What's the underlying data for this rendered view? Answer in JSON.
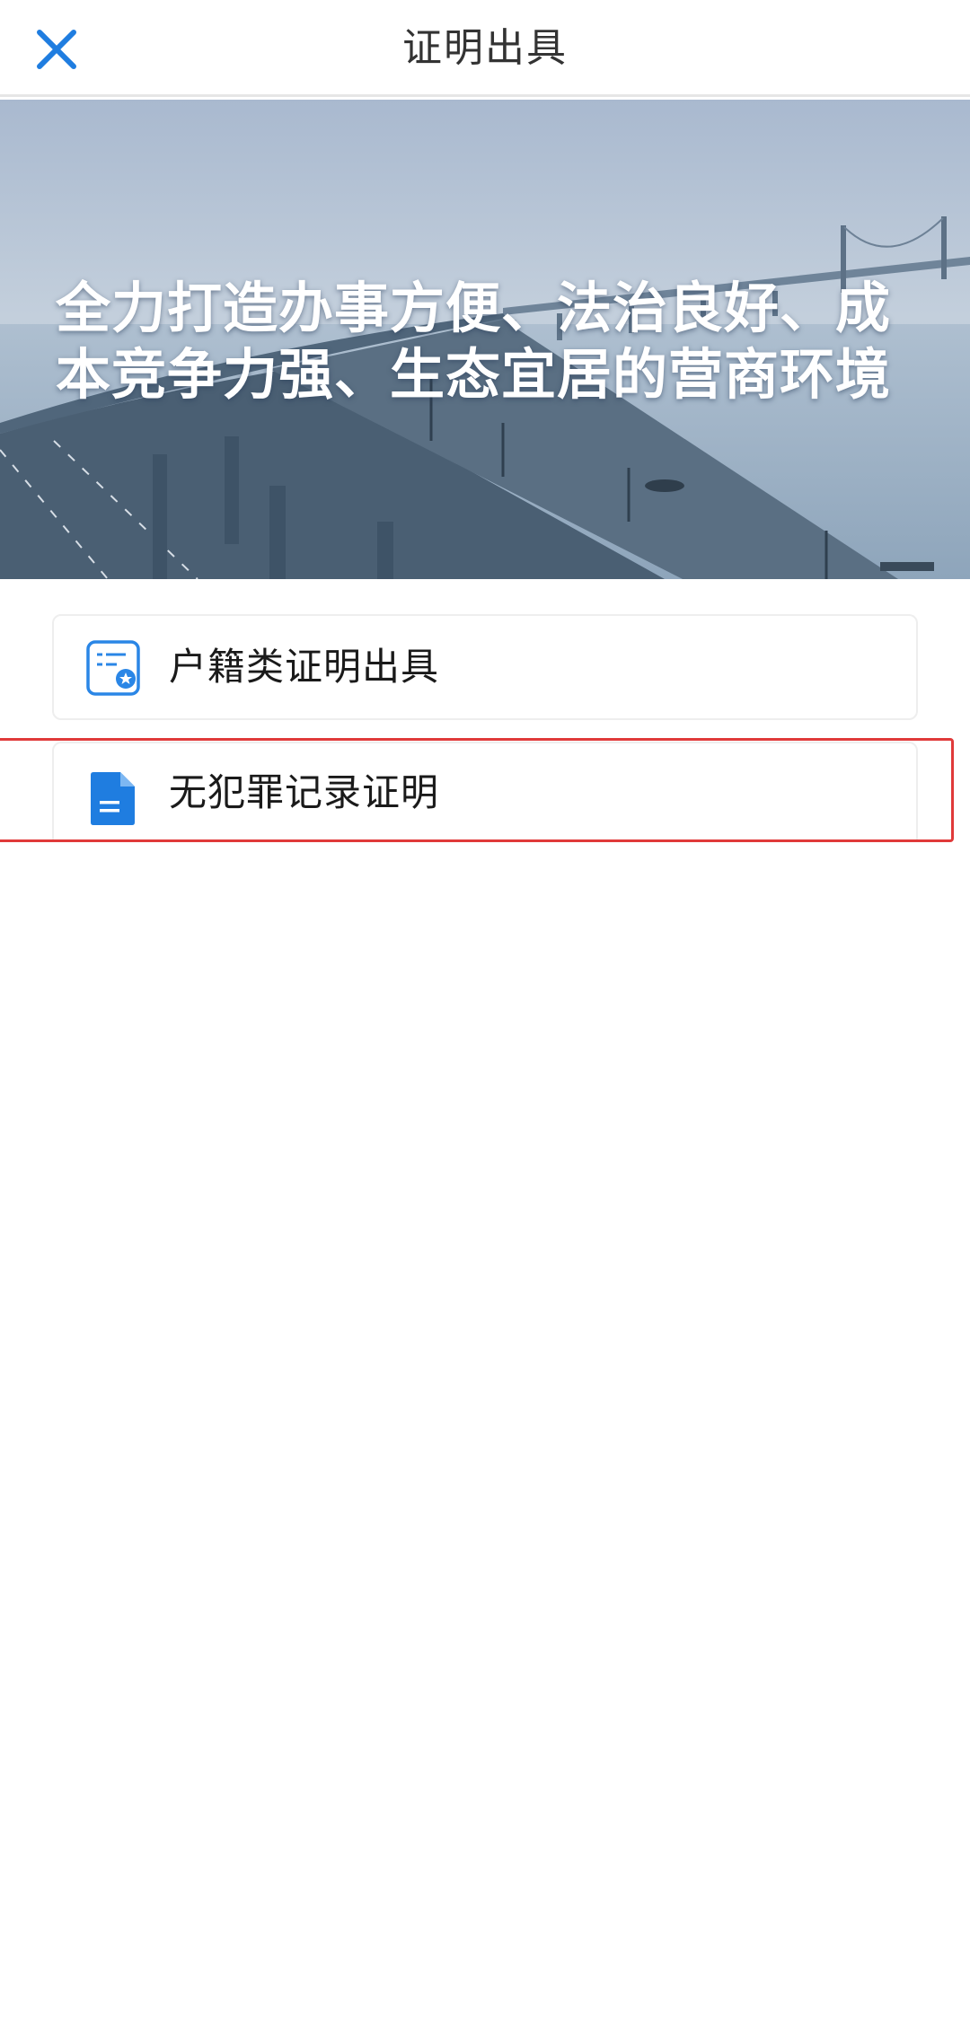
{
  "header": {
    "title": "证明出具",
    "close_icon": "close-icon",
    "accent_color": "#1f7de0"
  },
  "banner": {
    "line1": "全力打造办事方便、法治良好、成",
    "line2": "本竞争力强、生态宜居的营商环境"
  },
  "items": [
    {
      "label": "户籍类证明出具",
      "icon": "certificate-icon"
    },
    {
      "label": "无犯罪记录证明",
      "icon": "document-icon"
    }
  ],
  "highlight_color": "#e03a3a"
}
